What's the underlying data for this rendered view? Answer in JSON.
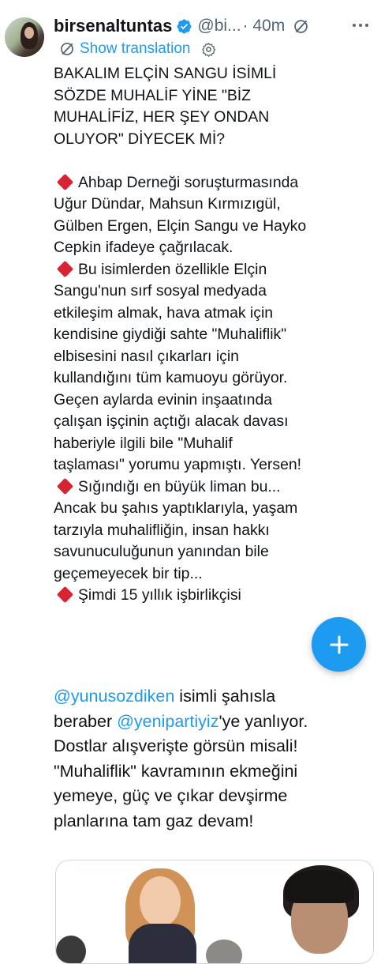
{
  "tweet": {
    "author_name": "birsenaltuntas",
    "handle": "@bi...",
    "time": "· 40m",
    "translate_label": "Show translation",
    "intro": [
      "BAKALIM ELÇİN SANGU İSİMLİ",
      "SÖZDE MUHALİF YİNE  \"BİZ",
      "MUHALİFİZ, HER ŞEY ONDAN",
      "OLUYOR\" DİYECEK Mİ?"
    ],
    "bullet1": [
      "Ahbap Derneği soruşturmasında",
      "Uğur Dündar, Mahsun Kırmızıgül,",
      "Gülben Ergen, Elçin Sangu ve Hayko",
      "Cepkin ifadeye çağrılacak."
    ],
    "bullet2": [
      "Bu isimlerden özellikle Elçin",
      "Sangu'nun sırf sosyal medyada",
      "etkileşim almak, hava atmak için",
      "kendisine giydiği sahte \"Muhaliflik\"",
      "elbisesini nasıl çıkarları için",
      "kullandığını tüm kamuoyu görüyor.",
      "Geçen aylarda evinin inşaatında",
      "çalışan işçinin açtığı alacak davası",
      "haberiyle ilgili bile \"Muhalif",
      "taşlaması\" yorumu yapmıştı. Yersen!"
    ],
    "bullet3": [
      "Sığındığı en büyük liman bu...",
      "Ancak bu şahıs yaptıklarıyla, yaşam",
      "tarzıyla muhalifliğin, insan hakkı",
      "savunuculuğunun yanından bile",
      "geçemeyecek bir tip..."
    ],
    "bullet4": "Şimdi 15 yıllık işbirlikçisi",
    "closing": {
      "mention1": "@yunusozdiken",
      "text1": " isimli şahısla",
      "text2_prefix": "beraber ",
      "mention2": "@yenipartiyiz",
      "text2_suffix": "'ye yanlıyor.",
      "lines": [
        "Dostlar alışverişte görsün misali!",
        "\"Muhaliflik\" kavramının ekmeğini",
        "yemeye, güç ve çıkar devşirme",
        "planlarına tam gaz devam!"
      ]
    }
  },
  "colors": {
    "accent": "#1d9bf0",
    "bullet": "#d62433",
    "text": "#0f1419",
    "muted": "#536471"
  },
  "icons": {
    "verified": "verified-badge-icon",
    "grok": "grok-icon",
    "more": "more-icon",
    "translate": "grok-translate-icon",
    "settings": "settings-icon",
    "compose": "plus-icon",
    "bullet": "red-diamond-icon"
  }
}
